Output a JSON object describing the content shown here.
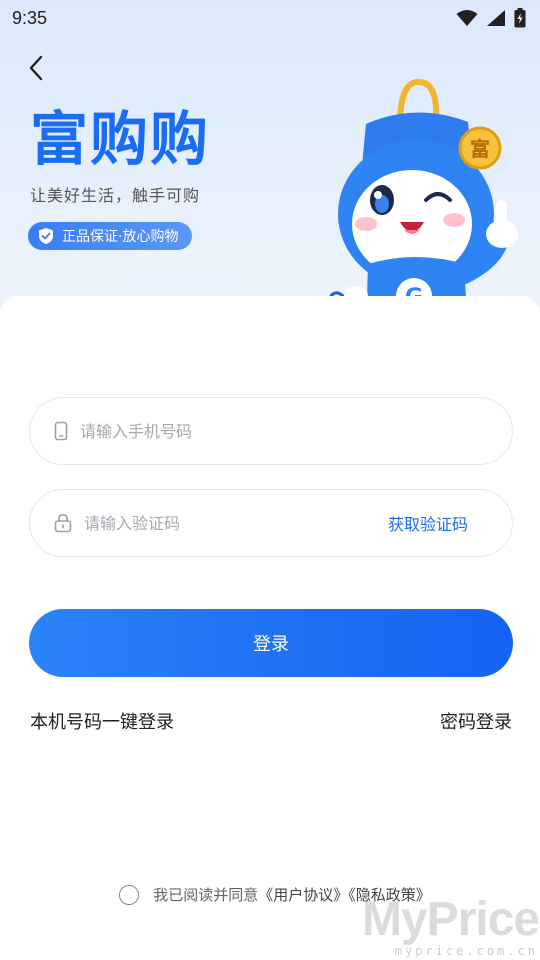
{
  "status_bar": {
    "time": "9:35",
    "icons": [
      "wifi-icon",
      "signal-icon",
      "battery-charging-icon"
    ]
  },
  "header": {
    "back_icon": "chevron-left-icon",
    "brand_title": "富购购",
    "slogan": "让美好生活，触手可购",
    "badge_text": "正品保证·放心购物",
    "badge_icon": "shield-check-icon"
  },
  "mascot": {
    "hat_badge": "富",
    "hoodie_letter": "G"
  },
  "form": {
    "phone_placeholder": "请输入手机号码",
    "phone_icon": "phone-icon",
    "code_placeholder": "请输入验证码",
    "code_icon": "lock-icon",
    "get_code_label": "获取验证码",
    "login_label": "登录",
    "one_click_login": "本机号码一键登录",
    "password_login": "密码登录"
  },
  "agreement": {
    "prefix": "我已阅读并同意",
    "user_agreement": "《用户协议》",
    "privacy_policy": "《隐私政策》"
  },
  "watermark": {
    "main": "MyPrice",
    "sub": "myprice.com.cn"
  },
  "colors": {
    "accent": "#1a6cf5",
    "hero_background": "#e3eefc",
    "button_gradient_start": "#2b83f8",
    "button_gradient_end": "#1662f2"
  }
}
